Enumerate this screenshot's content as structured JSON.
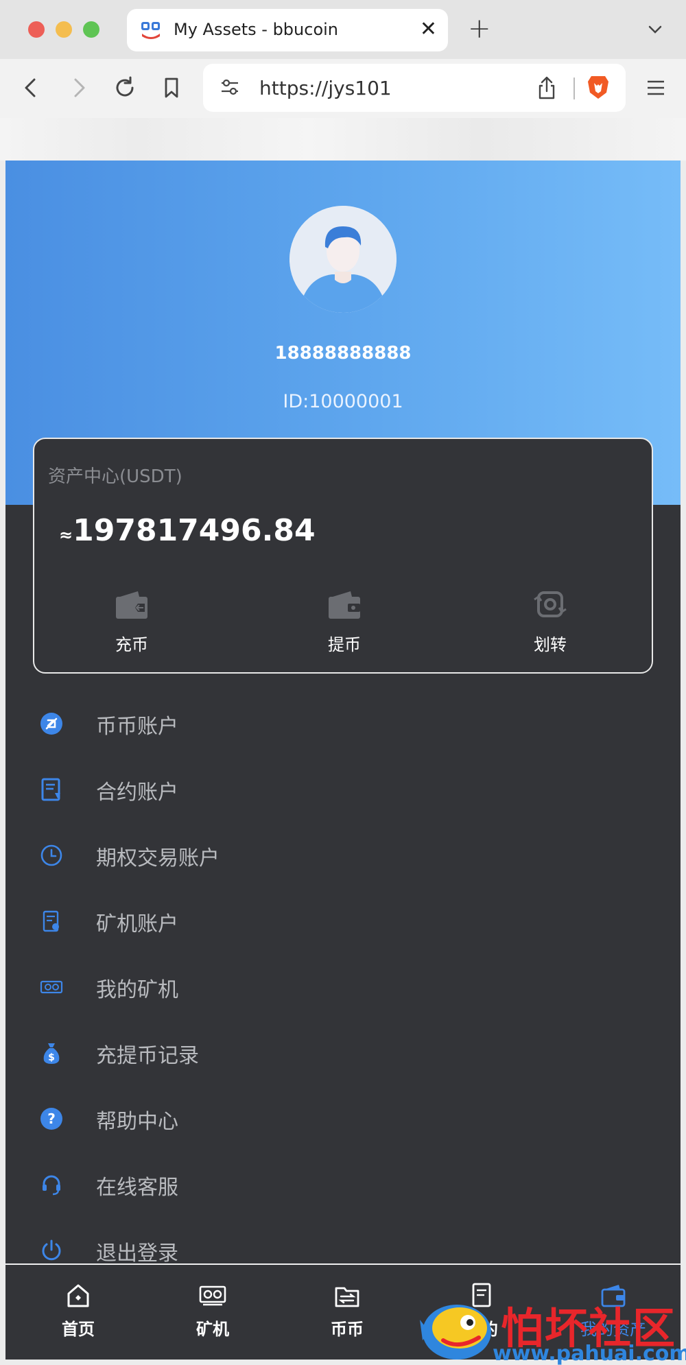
{
  "browser": {
    "tab_title": "My Assets - bbucoin",
    "url": "https://jys101",
    "icons": [
      "back-icon",
      "forward-icon",
      "reload-icon",
      "bookmark-icon",
      "site-settings-icon",
      "share-icon",
      "brave-shield-icon",
      "menu-icon"
    ]
  },
  "profile": {
    "phone": "18888888888",
    "id_label": "ID:10000001"
  },
  "assets": {
    "title": "资产中心(USDT)",
    "approx": "≈",
    "balance": "197817496.84",
    "actions": [
      {
        "label": "充币",
        "icon": "wallet-deposit-icon"
      },
      {
        "label": "提币",
        "icon": "wallet-withdraw-icon"
      },
      {
        "label": "划转",
        "icon": "transfer-icon"
      }
    ]
  },
  "menu": [
    {
      "label": "币币账户",
      "icon": "coin-account-icon"
    },
    {
      "label": "合约账户",
      "icon": "contract-account-icon"
    },
    {
      "label": "期权交易账户",
      "icon": "clock-icon"
    },
    {
      "label": "矿机账户",
      "icon": "miner-account-icon"
    },
    {
      "label": "我的矿机",
      "icon": "gpu-miner-icon"
    },
    {
      "label": "充提币记录",
      "icon": "money-bag-icon"
    },
    {
      "label": "帮助中心",
      "icon": "help-icon"
    },
    {
      "label": "在线客服",
      "icon": "headset-icon"
    },
    {
      "label": "退出登录",
      "icon": "power-icon"
    }
  ],
  "bottom_nav": [
    {
      "label": "首页",
      "icon": "home-icon"
    },
    {
      "label": "矿机",
      "icon": "miner-icon"
    },
    {
      "label": "币币",
      "icon": "exchange-icon"
    },
    {
      "label": "合约",
      "icon": "contract-icon"
    },
    {
      "label": "我的资产",
      "icon": "wallet-icon",
      "active": true
    }
  ],
  "watermark": {
    "text": "怕坏社区",
    "url": "www.pahuai.com"
  },
  "colors": {
    "accent": "#3d86e8",
    "hero_start": "#4a8fe2",
    "hero_end": "#76bcf8",
    "page_bg": "#333438",
    "watermark_red": "#e8262b"
  }
}
